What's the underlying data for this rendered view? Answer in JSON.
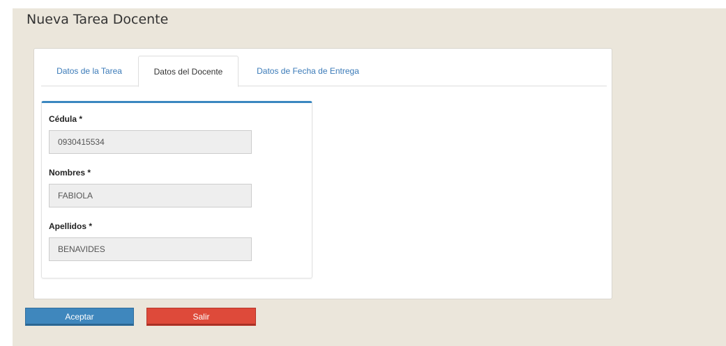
{
  "page": {
    "title": "Nueva Tarea Docente"
  },
  "tabs": [
    {
      "label": "Datos de la Tarea",
      "active": false
    },
    {
      "label": "Datos del Docente",
      "active": true
    },
    {
      "label": "Datos de Fecha de Entrega",
      "active": false
    }
  ],
  "form": {
    "cedula": {
      "label": "Cédula *",
      "value": "0930415534"
    },
    "nombres": {
      "label": "Nombres *",
      "value": "FABIOLA"
    },
    "apellidos": {
      "label": "Apellidos *",
      "value": "BENAVIDES"
    }
  },
  "actions": {
    "accept_label": "Aceptar",
    "exit_label": "Salir"
  },
  "colors": {
    "page_background": "#ebe6db",
    "tab_link": "#3a7ab8",
    "panel_accent": "#3a87c0",
    "accept_button": "#3f87bd",
    "exit_button": "#de4a3a"
  }
}
